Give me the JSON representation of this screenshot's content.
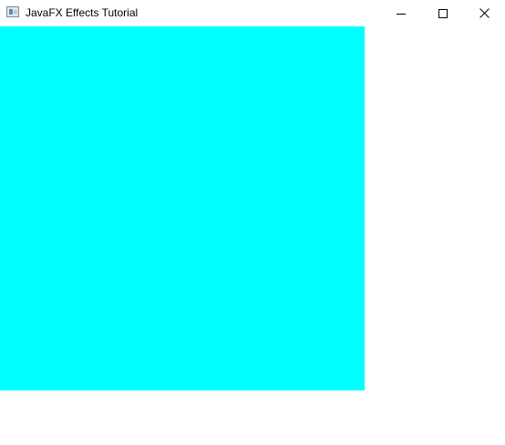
{
  "window": {
    "title": "JavaFX Effects Tutorial",
    "icon": "java-app-icon",
    "controls": {
      "minimize_icon": "minimize-icon",
      "maximize_icon": "maximize-icon",
      "close_icon": "close-icon"
    }
  },
  "scene": {
    "background_color": "#ffffff",
    "rectangle_color": "#00ffff"
  }
}
